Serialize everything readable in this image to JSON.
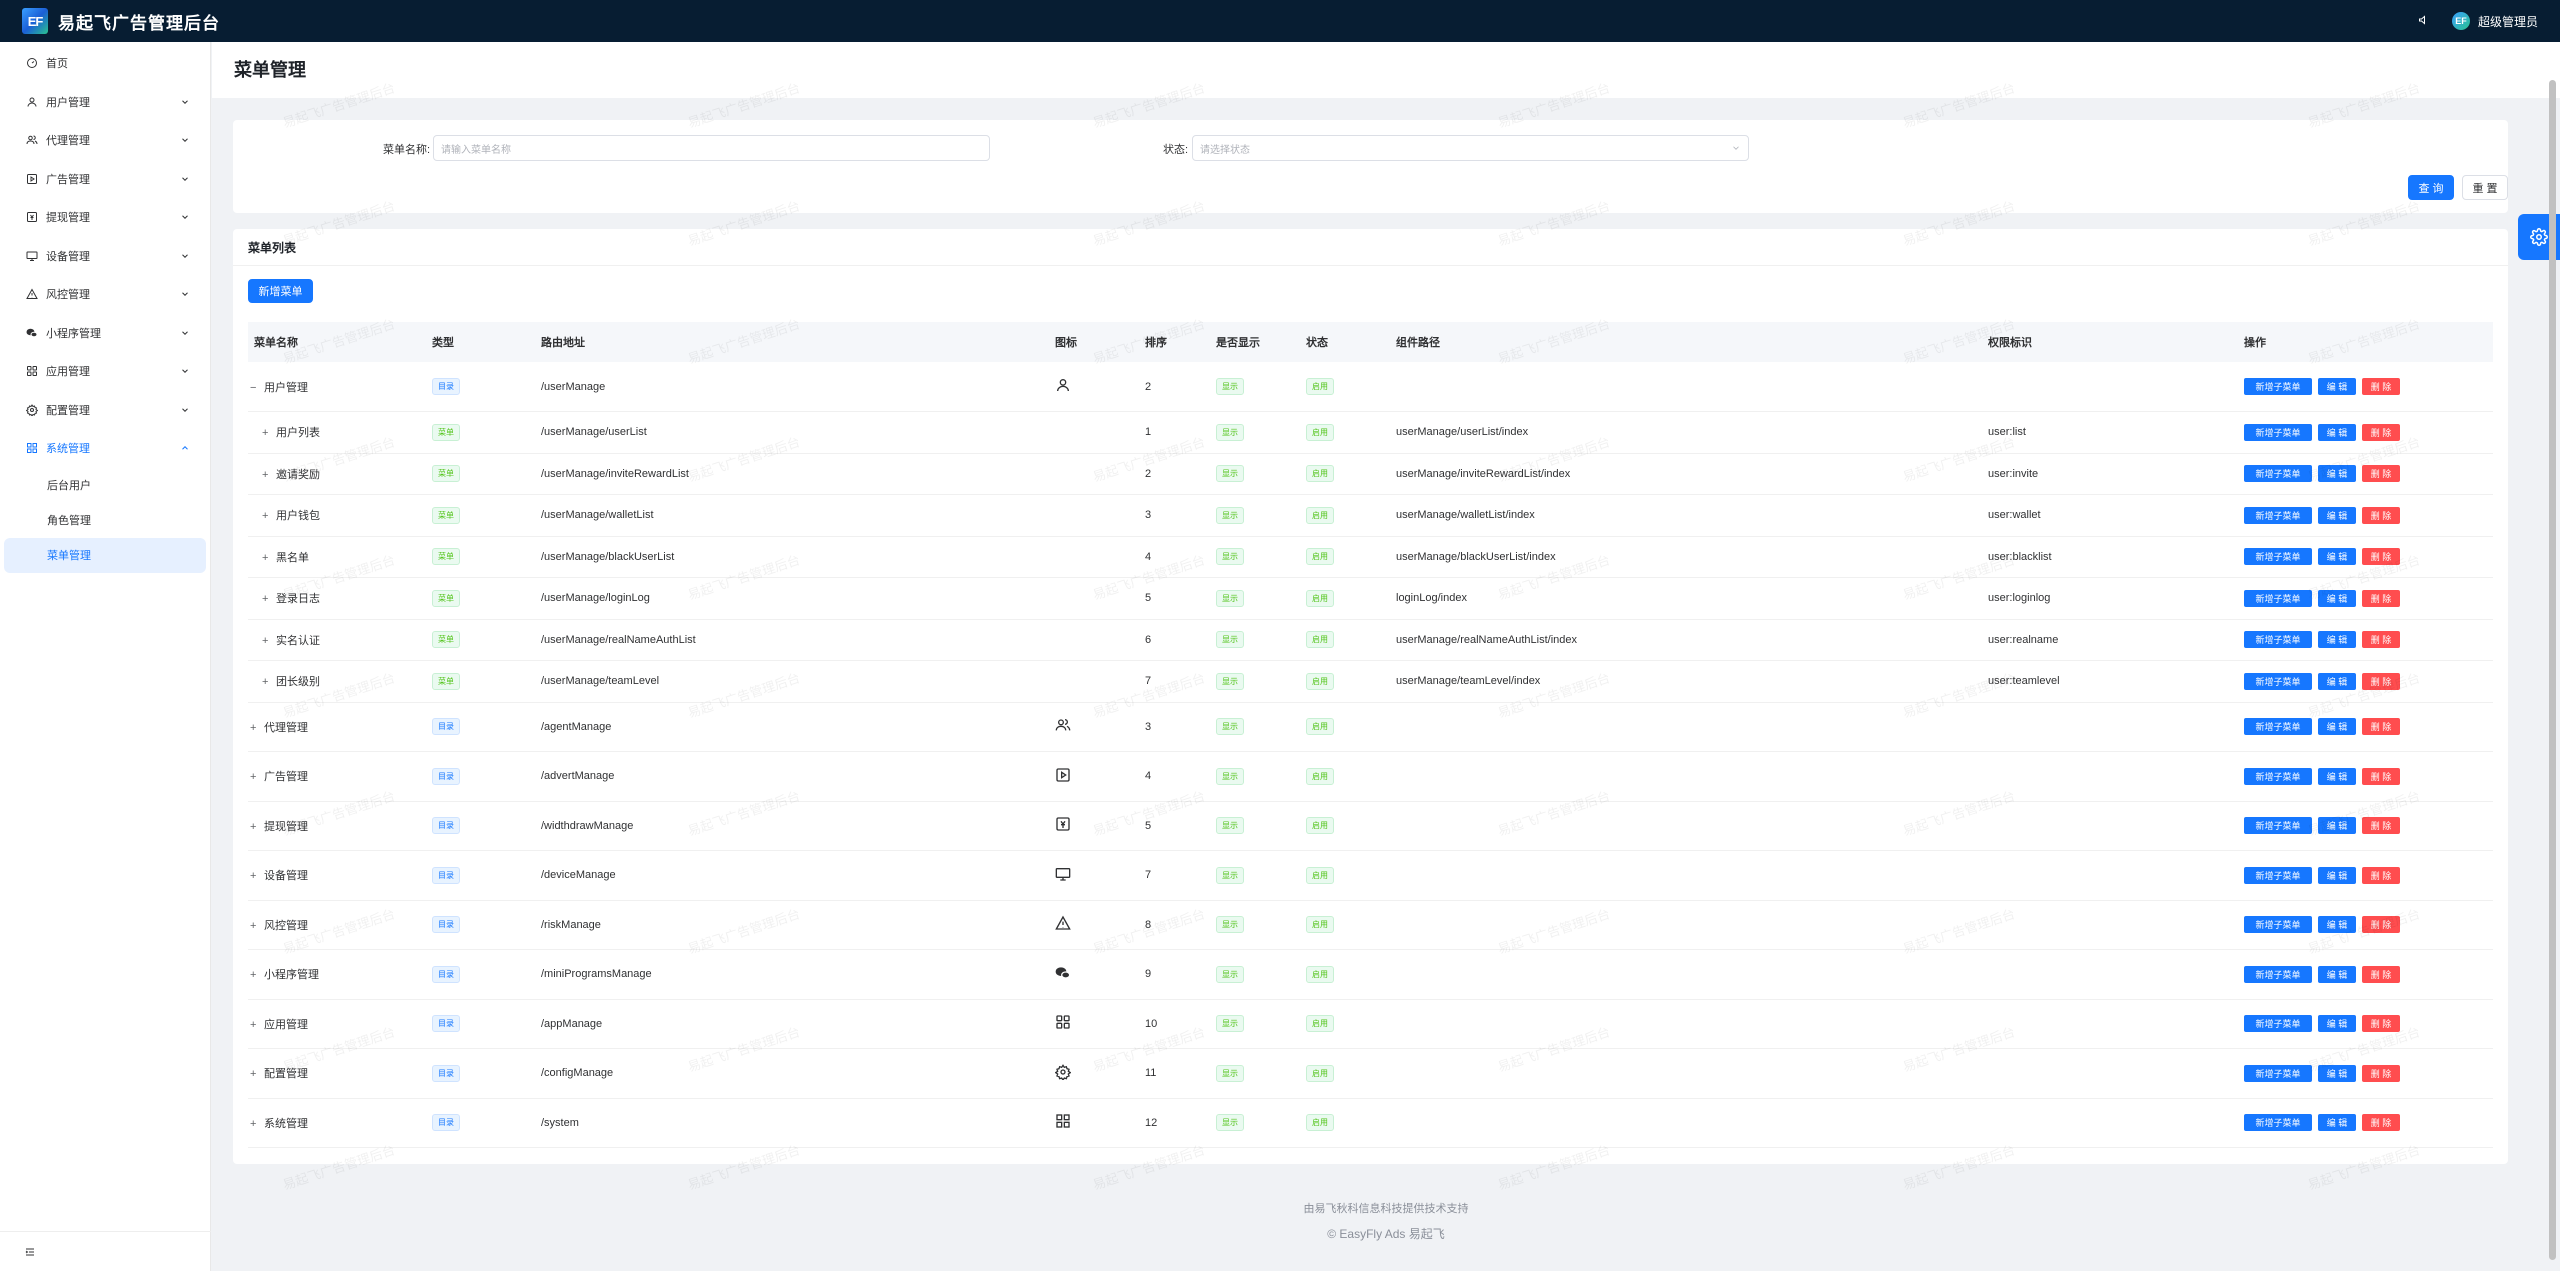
{
  "app": {
    "logo_text": "EF",
    "title": "易起飞广告管理后台"
  },
  "topbar": {
    "user_avatar_text": "EF",
    "user_name": "超级管理员"
  },
  "sidebar": {
    "items": [
      {
        "label": "首页",
        "icon": "dashboard-icon",
        "expandable": false
      },
      {
        "label": "用户管理",
        "icon": "user-icon",
        "expandable": true
      },
      {
        "label": "代理管理",
        "icon": "agent-icon",
        "expandable": true
      },
      {
        "label": "广告管理",
        "icon": "play-icon",
        "expandable": true
      },
      {
        "label": "提现管理",
        "icon": "withdraw-icon",
        "expandable": true
      },
      {
        "label": "设备管理",
        "icon": "monitor-icon",
        "expandable": true
      },
      {
        "label": "风控管理",
        "icon": "warning-icon",
        "expandable": true
      },
      {
        "label": "小程序管理",
        "icon": "wechat-icon",
        "expandable": true
      },
      {
        "label": "应用管理",
        "icon": "apps-icon",
        "expandable": true
      },
      {
        "label": "配置管理",
        "icon": "gear-icon",
        "expandable": true
      },
      {
        "label": "系统管理",
        "icon": "system-icon",
        "expandable": true,
        "active": true
      }
    ],
    "sub_items": [
      "后台用户",
      "角色管理",
      "菜单管理"
    ],
    "active_sub": "菜单管理"
  },
  "page": {
    "title": "菜单管理"
  },
  "search": {
    "name_label": "菜单名称:",
    "name_placeholder": "请输入菜单名称",
    "status_label": "状态:",
    "status_placeholder": "请选择状态",
    "query_label": "查 询",
    "reset_label": "重 置"
  },
  "list": {
    "title": "菜单列表",
    "add_label": "新增菜单",
    "columns": [
      "菜单名称",
      "类型",
      "路由地址",
      "图标",
      "排序",
      "是否显示",
      "状态",
      "组件路径",
      "权限标识",
      "操作"
    ],
    "op_add": "新增子菜单",
    "op_edit": "编 辑",
    "op_delete": "删 除",
    "rows": [
      {
        "level": "parent",
        "expander": "−",
        "name": "用户管理",
        "type": "目录",
        "path": "/userManage",
        "icon": "user-icon",
        "sort": "2",
        "visible": "显示",
        "status": "启用",
        "component": "",
        "perm": ""
      },
      {
        "level": "child",
        "expander": "+",
        "name": "用户列表",
        "type": "菜单",
        "path": "/userManage/userList",
        "icon": "",
        "sort": "1",
        "visible": "显示",
        "status": "启用",
        "component": "userManage/userList/index",
        "perm": "user:list"
      },
      {
        "level": "child",
        "expander": "+",
        "name": "邀请奖励",
        "type": "菜单",
        "path": "/userManage/inviteRewardList",
        "icon": "",
        "sort": "2",
        "visible": "显示",
        "status": "启用",
        "component": "userManage/inviteRewardList/index",
        "perm": "user:invite"
      },
      {
        "level": "child",
        "expander": "+",
        "name": "用户钱包",
        "type": "菜单",
        "path": "/userManage/walletList",
        "icon": "",
        "sort": "3",
        "visible": "显示",
        "status": "启用",
        "component": "userManage/walletList/index",
        "perm": "user:wallet"
      },
      {
        "level": "child",
        "expander": "+",
        "name": "黑名单",
        "type": "菜单",
        "path": "/userManage/blackUserList",
        "icon": "",
        "sort": "4",
        "visible": "显示",
        "status": "启用",
        "component": "userManage/blackUserList/index",
        "perm": "user:blacklist"
      },
      {
        "level": "child",
        "expander": "+",
        "name": "登录日志",
        "type": "菜单",
        "path": "/userManage/loginLog",
        "icon": "",
        "sort": "5",
        "visible": "显示",
        "status": "启用",
        "component": "loginLog/index",
        "perm": "user:loginlog"
      },
      {
        "level": "child",
        "expander": "+",
        "name": "实名认证",
        "type": "菜单",
        "path": "/userManage/realNameAuthList",
        "icon": "",
        "sort": "6",
        "visible": "显示",
        "status": "启用",
        "component": "userManage/realNameAuthList/index",
        "perm": "user:realname"
      },
      {
        "level": "child",
        "expander": "+",
        "name": "团长级别",
        "type": "菜单",
        "path": "/userManage/teamLevel",
        "icon": "",
        "sort": "7",
        "visible": "显示",
        "status": "启用",
        "component": "userManage/teamLevel/index",
        "perm": "user:teamlevel"
      },
      {
        "level": "parent",
        "expander": "+",
        "name": "代理管理",
        "type": "目录",
        "path": "/agentManage",
        "icon": "agent-icon",
        "sort": "3",
        "visible": "显示",
        "status": "启用",
        "component": "",
        "perm": ""
      },
      {
        "level": "parent",
        "expander": "+",
        "name": "广告管理",
        "type": "目录",
        "path": "/advertManage",
        "icon": "play-icon",
        "sort": "4",
        "visible": "显示",
        "status": "启用",
        "component": "",
        "perm": ""
      },
      {
        "level": "parent",
        "expander": "+",
        "name": "提现管理",
        "type": "目录",
        "path": "/widthdrawManage",
        "icon": "withdraw-icon",
        "sort": "5",
        "visible": "显示",
        "status": "启用",
        "component": "",
        "perm": ""
      },
      {
        "level": "parent",
        "expander": "+",
        "name": "设备管理",
        "type": "目录",
        "path": "/deviceManage",
        "icon": "monitor-icon",
        "sort": "7",
        "visible": "显示",
        "status": "启用",
        "component": "",
        "perm": ""
      },
      {
        "level": "parent",
        "expander": "+",
        "name": "风控管理",
        "type": "目录",
        "path": "/riskManage",
        "icon": "warning-icon",
        "sort": "8",
        "visible": "显示",
        "status": "启用",
        "component": "",
        "perm": ""
      },
      {
        "level": "parent",
        "expander": "+",
        "name": "小程序管理",
        "type": "目录",
        "path": "/miniProgramsManage",
        "icon": "wechat-icon",
        "sort": "9",
        "visible": "显示",
        "status": "启用",
        "component": "",
        "perm": ""
      },
      {
        "level": "parent",
        "expander": "+",
        "name": "应用管理",
        "type": "目录",
        "path": "/appManage",
        "icon": "apps-icon",
        "sort": "10",
        "visible": "显示",
        "status": "启用",
        "component": "",
        "perm": ""
      },
      {
        "level": "parent",
        "expander": "+",
        "name": "配置管理",
        "type": "目录",
        "path": "/configManage",
        "icon": "gear-icon",
        "sort": "11",
        "visible": "显示",
        "status": "启用",
        "component": "",
        "perm": ""
      },
      {
        "level": "parent",
        "expander": "+",
        "name": "系统管理",
        "type": "目录",
        "path": "/system",
        "icon": "system-icon",
        "sort": "12",
        "visible": "显示",
        "status": "启用",
        "component": "",
        "perm": ""
      }
    ]
  },
  "footer": {
    "line1": "由易飞秋科信息科技提供技术支持",
    "line2": "© EasyFly Ads 易起飞"
  },
  "watermark": "易起飞广告管理后台",
  "colors": {
    "primary": "#1677ff",
    "danger": "#ff4d4f",
    "topbar": "#071d32",
    "success": "#52c41a"
  }
}
